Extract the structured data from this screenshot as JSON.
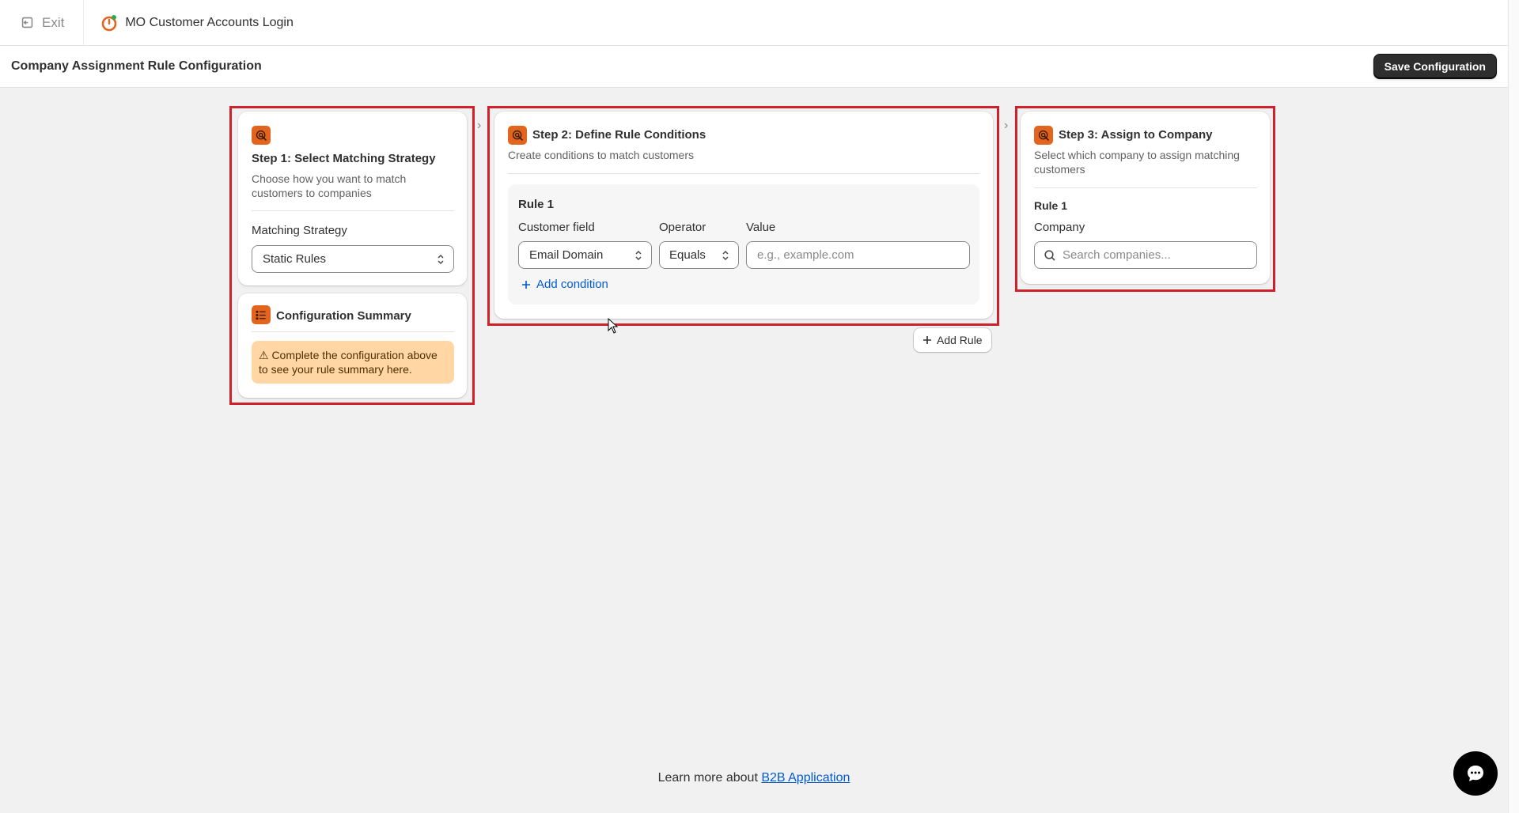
{
  "topbar": {
    "exit_label": "Exit",
    "app_name": "MO Customer Accounts Login"
  },
  "page": {
    "title": "Company Assignment Rule Configuration",
    "save_label": "Save Configuration"
  },
  "step1": {
    "title": "Step 1: Select Matching Strategy",
    "description": "Choose how you want to match customers to companies",
    "field_label": "Matching Strategy",
    "selected": "Static Rules"
  },
  "summary": {
    "title": "Configuration Summary",
    "warning": "⚠ Complete the configuration above to see your rule summary here."
  },
  "step2": {
    "title": "Step 2: Define Rule Conditions",
    "description": "Create conditions to match customers",
    "rule_title": "Rule 1",
    "customer_field_label": "Customer field",
    "customer_field_value": "Email Domain",
    "operator_label": "Operator",
    "operator_value": "Equals",
    "value_label": "Value",
    "value_placeholder": "e.g., example.com",
    "add_condition": "Add condition",
    "add_rule": "Add Rule"
  },
  "step3": {
    "title": "Step 3: Assign to Company",
    "description": "Select which company to assign matching customers",
    "rule_title": "Rule 1",
    "company_label": "Company",
    "search_placeholder": "Search companies..."
  },
  "footer": {
    "prefix": "Learn more about ",
    "link": "B2B Application"
  },
  "colors": {
    "accent": "#e3651d",
    "highlight": "#d0202a",
    "link": "#005bd3",
    "warning_bg": "#ffd6a4"
  }
}
